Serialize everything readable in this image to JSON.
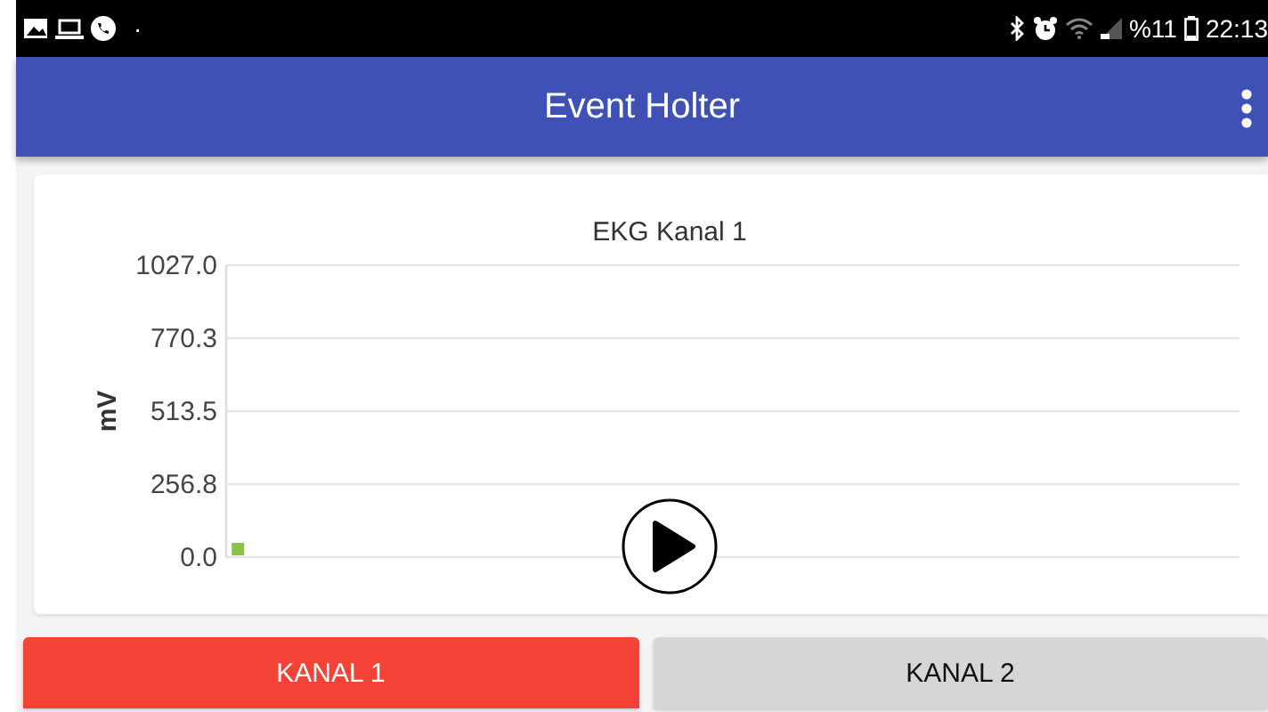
{
  "status_bar": {
    "battery_text": "%11",
    "time": "22:13",
    "dot": "·"
  },
  "app_bar": {
    "title": "Event Holter"
  },
  "chart": {
    "chart_data": {
      "type": "line",
      "categories": [
        null,
        null,
        null,
        null,
        null,
        null,
        null,
        null,
        null,
        null,
        null,
        null,
        null,
        null,
        null,
        null,
        null,
        null,
        null,
        null,
        null,
        null,
        null,
        null,
        null,
        null,
        null,
        null,
        null,
        null,
        null,
        null,
        null,
        null,
        null,
        null,
        null,
        null,
        null,
        null
      ],
      "title": "EKG Kanal 1",
      "ylabel": "mV",
      "grid": true,
      "ylim": [
        0,
        1027.0
      ],
      "yticks": [
        {
          "value": 0,
          "label": "0.0"
        },
        {
          "value": 256.8,
          "label": "256.8"
        },
        {
          "value": 513.5,
          "label": "513.5"
        },
        {
          "value": 770.3,
          "label": "770.3"
        },
        {
          "value": 1027.0,
          "label": "1027.0"
        }
      ],
      "series": [
        {
          "color": "#8bc34a",
          "marker": "square",
          "values": [
            25,
            null,
            null,
            null,
            null,
            null,
            null,
            null,
            null,
            null,
            null,
            null,
            null,
            null,
            null,
            null,
            null,
            null,
            null,
            null,
            null,
            null,
            null,
            null,
            null,
            null,
            null,
            null,
            null,
            null,
            null,
            null,
            null,
            null,
            null,
            null,
            null,
            null,
            null,
            null
          ]
        }
      ]
    }
  },
  "tabs": [
    {
      "label": "KANAL 1",
      "selected": true
    },
    {
      "label": "KANAL 2",
      "selected": false
    }
  ]
}
